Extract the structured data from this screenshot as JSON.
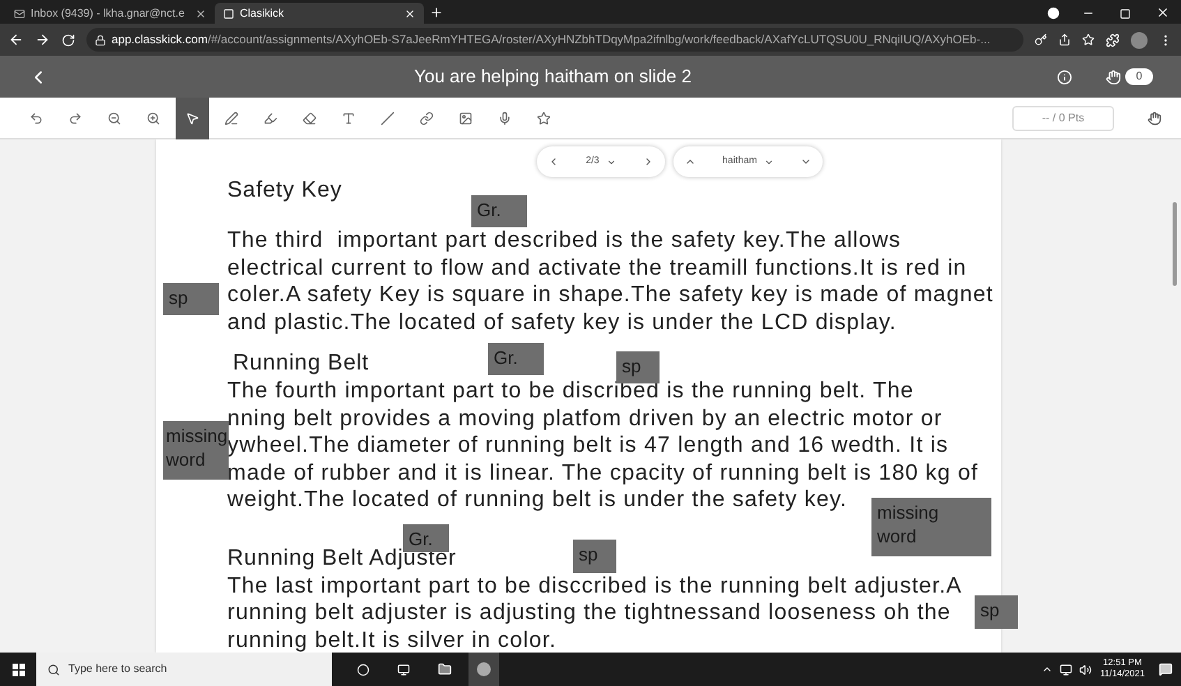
{
  "browser": {
    "tabs": [
      {
        "title": "Inbox (9439) - lkha.gnar@nct.e",
        "selected": false
      },
      {
        "title": "Clasikick",
        "selected": true
      }
    ],
    "address": {
      "host": "app.classkick.com",
      "path": "/#/account/assignments/AXyhOEb-S7aJeeRmYHTEGA/roster/AXyHNZbhTDqyMpa2ifnlbg/work/feedback/AXafYcLUTQSU0U_RNqiIUQ/AXyhOEb-..."
    }
  },
  "header": {
    "title": "You are helping haitham on slide 2",
    "badge": "0"
  },
  "toolbar": {
    "tools": [
      {
        "kind": "undo",
        "selected": false
      },
      {
        "kind": "redo",
        "selected": false
      },
      {
        "kind": "zoom-out",
        "selected": false
      },
      {
        "kind": "zoom-in",
        "selected": false
      },
      {
        "kind": "pointer",
        "selected": true
      },
      {
        "kind": "pen",
        "selected": false
      },
      {
        "kind": "highlighter",
        "selected": false
      },
      {
        "kind": "eraser",
        "selected": false
      },
      {
        "kind": "text",
        "selected": false
      },
      {
        "kind": "line",
        "selected": false
      },
      {
        "kind": "link",
        "selected": false
      },
      {
        "kind": "image",
        "selected": false
      },
      {
        "kind": "audio",
        "selected": false
      },
      {
        "kind": "sticker",
        "selected": false
      }
    ],
    "points": "-- / 0 Pts"
  },
  "slide_nav": {
    "position": "2/3",
    "student": "haitham"
  },
  "sections": [
    {
      "heading": "Safety Key",
      "lines": [
        "The third  important part described is the safety key.The allows",
        "electrical current to flow and activate the treamill functions.It is red in",
        "coler.A safety Key is square in shape.The safety key is made of magnet",
        "and plastic.The located of safety key is under the LCD display."
      ]
    },
    {
      "heading": "Running Belt",
      "lines": [
        "The fourth important part to be discribed is the running belt. The",
        "nning belt provides a moving platfom driven by an electric motor or",
        "ywheel.The diameter of running belt is 47 length and 16 wedth. It is",
        "made of rubber and it is linear. The cpacity of running belt is 180 kg of",
        "weight.The located of running belt is under the safety key."
      ]
    },
    {
      "heading": "Running Belt Adjuster",
      "lines": [
        "The last important part to be disccribed is the running belt adjuster.A",
        "running belt adjuster is adjusting the tightnessand looseness oh the",
        "running belt.It is silver in color."
      ]
    }
  ],
  "annotations": [
    "Gr.",
    "sp",
    "Gr.",
    "sp",
    "missing word",
    "Gr.",
    "missing word",
    "sp",
    "sp"
  ],
  "taskbar": {
    "search": {
      "placeholder": "Type here to search"
    },
    "time": "12:51 PM",
    "date": "11/14/2021"
  }
}
